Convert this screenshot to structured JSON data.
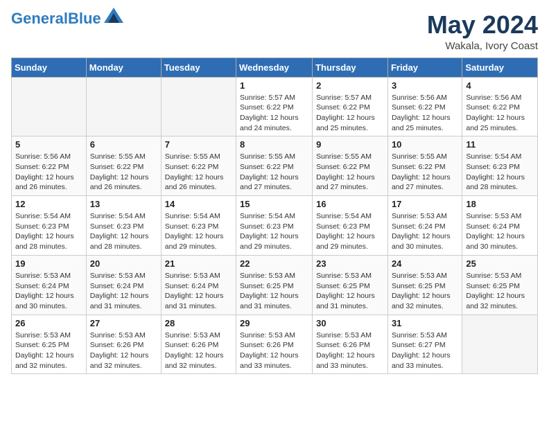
{
  "header": {
    "logo_line1": "General",
    "logo_line2": "Blue",
    "month_year": "May 2024",
    "location": "Wakala, Ivory Coast"
  },
  "weekdays": [
    "Sunday",
    "Monday",
    "Tuesday",
    "Wednesday",
    "Thursday",
    "Friday",
    "Saturday"
  ],
  "weeks": [
    [
      {
        "day": "",
        "info": ""
      },
      {
        "day": "",
        "info": ""
      },
      {
        "day": "",
        "info": ""
      },
      {
        "day": "1",
        "info": "Sunrise: 5:57 AM\nSunset: 6:22 PM\nDaylight: 12 hours\nand 24 minutes."
      },
      {
        "day": "2",
        "info": "Sunrise: 5:57 AM\nSunset: 6:22 PM\nDaylight: 12 hours\nand 25 minutes."
      },
      {
        "day": "3",
        "info": "Sunrise: 5:56 AM\nSunset: 6:22 PM\nDaylight: 12 hours\nand 25 minutes."
      },
      {
        "day": "4",
        "info": "Sunrise: 5:56 AM\nSunset: 6:22 PM\nDaylight: 12 hours\nand 25 minutes."
      }
    ],
    [
      {
        "day": "5",
        "info": "Sunrise: 5:56 AM\nSunset: 6:22 PM\nDaylight: 12 hours\nand 26 minutes."
      },
      {
        "day": "6",
        "info": "Sunrise: 5:55 AM\nSunset: 6:22 PM\nDaylight: 12 hours\nand 26 minutes."
      },
      {
        "day": "7",
        "info": "Sunrise: 5:55 AM\nSunset: 6:22 PM\nDaylight: 12 hours\nand 26 minutes."
      },
      {
        "day": "8",
        "info": "Sunrise: 5:55 AM\nSunset: 6:22 PM\nDaylight: 12 hours\nand 27 minutes."
      },
      {
        "day": "9",
        "info": "Sunrise: 5:55 AM\nSunset: 6:22 PM\nDaylight: 12 hours\nand 27 minutes."
      },
      {
        "day": "10",
        "info": "Sunrise: 5:55 AM\nSunset: 6:22 PM\nDaylight: 12 hours\nand 27 minutes."
      },
      {
        "day": "11",
        "info": "Sunrise: 5:54 AM\nSunset: 6:23 PM\nDaylight: 12 hours\nand 28 minutes."
      }
    ],
    [
      {
        "day": "12",
        "info": "Sunrise: 5:54 AM\nSunset: 6:23 PM\nDaylight: 12 hours\nand 28 minutes."
      },
      {
        "day": "13",
        "info": "Sunrise: 5:54 AM\nSunset: 6:23 PM\nDaylight: 12 hours\nand 28 minutes."
      },
      {
        "day": "14",
        "info": "Sunrise: 5:54 AM\nSunset: 6:23 PM\nDaylight: 12 hours\nand 29 minutes."
      },
      {
        "day": "15",
        "info": "Sunrise: 5:54 AM\nSunset: 6:23 PM\nDaylight: 12 hours\nand 29 minutes."
      },
      {
        "day": "16",
        "info": "Sunrise: 5:54 AM\nSunset: 6:23 PM\nDaylight: 12 hours\nand 29 minutes."
      },
      {
        "day": "17",
        "info": "Sunrise: 5:53 AM\nSunset: 6:24 PM\nDaylight: 12 hours\nand 30 minutes."
      },
      {
        "day": "18",
        "info": "Sunrise: 5:53 AM\nSunset: 6:24 PM\nDaylight: 12 hours\nand 30 minutes."
      }
    ],
    [
      {
        "day": "19",
        "info": "Sunrise: 5:53 AM\nSunset: 6:24 PM\nDaylight: 12 hours\nand 30 minutes."
      },
      {
        "day": "20",
        "info": "Sunrise: 5:53 AM\nSunset: 6:24 PM\nDaylight: 12 hours\nand 31 minutes."
      },
      {
        "day": "21",
        "info": "Sunrise: 5:53 AM\nSunset: 6:24 PM\nDaylight: 12 hours\nand 31 minutes."
      },
      {
        "day": "22",
        "info": "Sunrise: 5:53 AM\nSunset: 6:25 PM\nDaylight: 12 hours\nand 31 minutes."
      },
      {
        "day": "23",
        "info": "Sunrise: 5:53 AM\nSunset: 6:25 PM\nDaylight: 12 hours\nand 31 minutes."
      },
      {
        "day": "24",
        "info": "Sunrise: 5:53 AM\nSunset: 6:25 PM\nDaylight: 12 hours\nand 32 minutes."
      },
      {
        "day": "25",
        "info": "Sunrise: 5:53 AM\nSunset: 6:25 PM\nDaylight: 12 hours\nand 32 minutes."
      }
    ],
    [
      {
        "day": "26",
        "info": "Sunrise: 5:53 AM\nSunset: 6:25 PM\nDaylight: 12 hours\nand 32 minutes."
      },
      {
        "day": "27",
        "info": "Sunrise: 5:53 AM\nSunset: 6:26 PM\nDaylight: 12 hours\nand 32 minutes."
      },
      {
        "day": "28",
        "info": "Sunrise: 5:53 AM\nSunset: 6:26 PM\nDaylight: 12 hours\nand 32 minutes."
      },
      {
        "day": "29",
        "info": "Sunrise: 5:53 AM\nSunset: 6:26 PM\nDaylight: 12 hours\nand 33 minutes."
      },
      {
        "day": "30",
        "info": "Sunrise: 5:53 AM\nSunset: 6:26 PM\nDaylight: 12 hours\nand 33 minutes."
      },
      {
        "day": "31",
        "info": "Sunrise: 5:53 AM\nSunset: 6:27 PM\nDaylight: 12 hours\nand 33 minutes."
      },
      {
        "day": "",
        "info": ""
      }
    ]
  ]
}
